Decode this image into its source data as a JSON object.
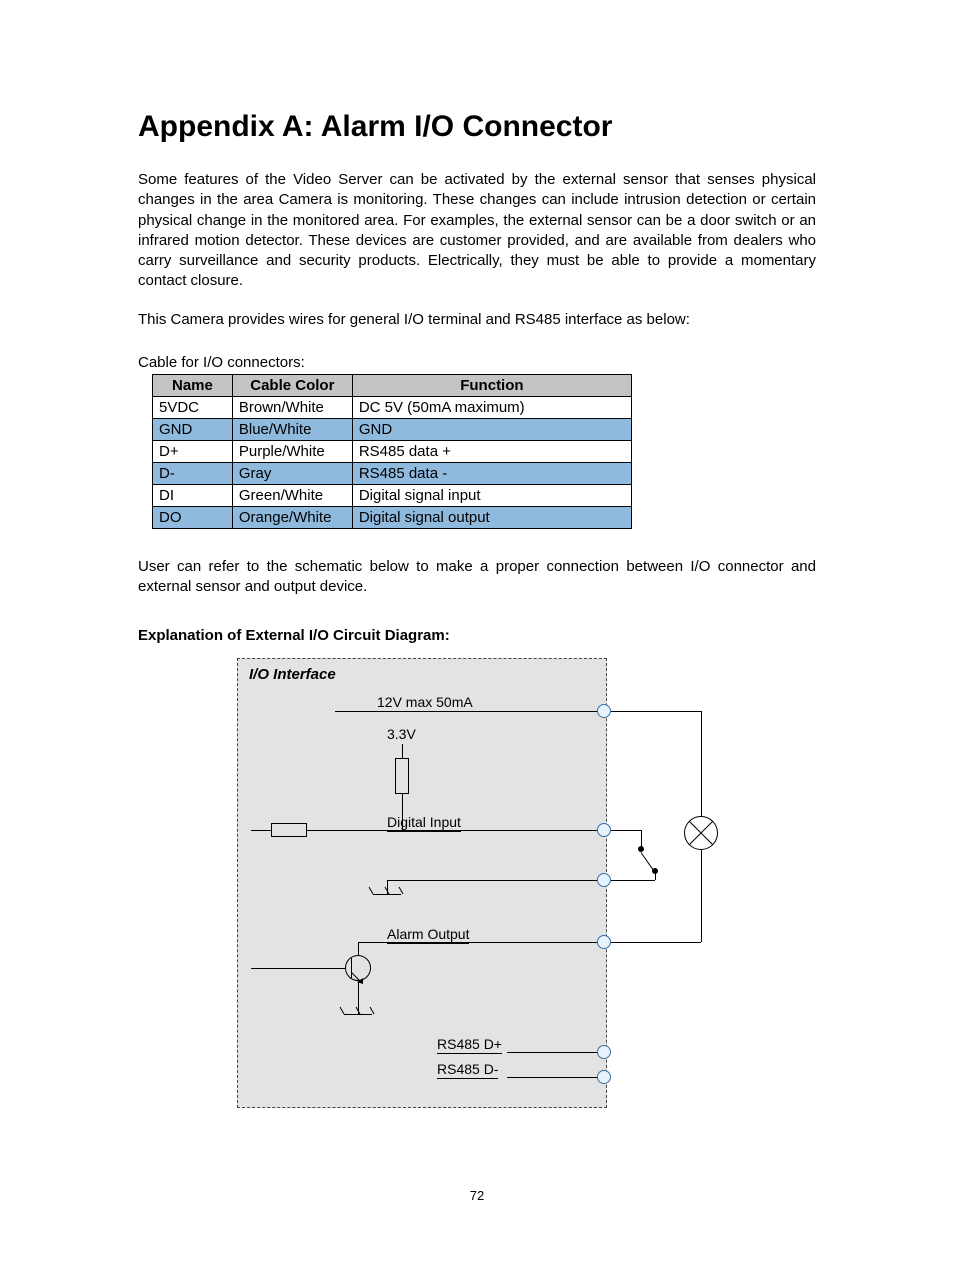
{
  "title": "Appendix A: Alarm I/O Connector",
  "para1": "Some features of the Video Server can be activated by the external sensor that senses physical changes in the area Camera is monitoring. These changes can include intrusion detection or certain physical change in the monitored area. For examples, the external sensor can be a door switch or an infrared motion detector. These devices are customer provided, and are available from dealers who carry surveillance and security products. Electrically, they must be able to provide a momentary contact closure.",
  "para2": "This Camera provides wires for general I/O terminal and RS485 interface as below:",
  "table_caption": "Cable for I/O connectors:",
  "table": {
    "headers": [
      "Name",
      "Cable Color",
      "Function"
    ],
    "rows": [
      {
        "name": "5VDC",
        "color": "Brown/White",
        "func": "DC 5V (50mA maximum)",
        "blue": false
      },
      {
        "name": "GND",
        "color": "Blue/White",
        "func": "GND",
        "blue": true
      },
      {
        "name": "D+",
        "color": "Purple/White",
        "func": "RS485 data +",
        "blue": false
      },
      {
        "name": "D-",
        "color": "Gray",
        "func": "RS485 data -",
        "blue": true
      },
      {
        "name": "DI",
        "color": "Green/White",
        "func": "Digital signal input",
        "blue": false
      },
      {
        "name": "DO",
        "color": "Orange/White",
        "func": "Digital signal output",
        "blue": true
      }
    ]
  },
  "para3": "User can refer to the schematic below to make a proper connection between I/O connector and external sensor and output device.",
  "subhead": "Explanation of External I/O Circuit Diagram:",
  "diagram": {
    "title": "I/O Interface",
    "labels": {
      "top": "12V max 50mA",
      "v33": "3.3V",
      "din": "Digital Input",
      "aout": "Alarm Output",
      "rsdp": "RS485 D+",
      "rsdm": "RS485 D-"
    }
  },
  "page_number": "72"
}
